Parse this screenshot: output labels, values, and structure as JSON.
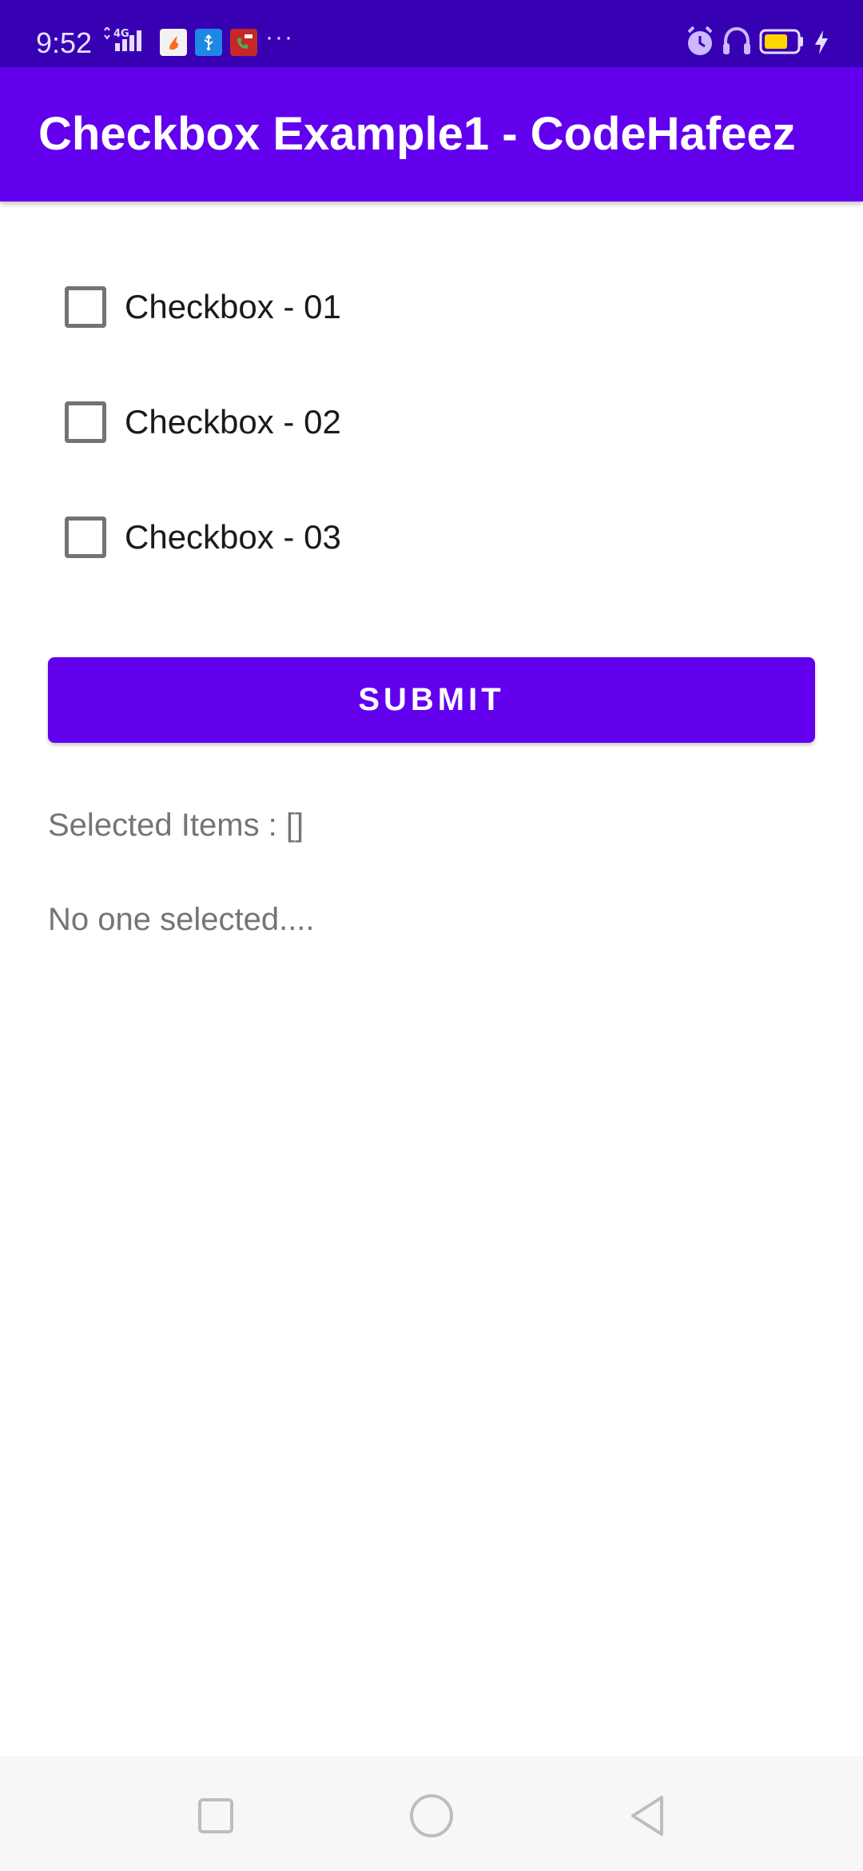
{
  "status_bar": {
    "time": "9:52",
    "network": "4G",
    "more": "···",
    "icons": [
      "signal-icon",
      "app-notification-icon",
      "usb-icon",
      "call-recording-icon",
      "alarm-icon",
      "headphones-icon",
      "battery-icon",
      "charging-icon"
    ]
  },
  "app_bar": {
    "title": "Checkbox Example1 - CodeHafeez"
  },
  "checkboxes": [
    {
      "label": "Checkbox - 01",
      "checked": false
    },
    {
      "label": "Checkbox - 02",
      "checked": false
    },
    {
      "label": "Checkbox - 03",
      "checked": false
    }
  ],
  "submit": {
    "label": "SUBMIT"
  },
  "results": {
    "selected_items": "Selected Items : []",
    "message": "No one selected...."
  },
  "nav_bar": {
    "icons": [
      "recents-square-icon",
      "home-circle-icon",
      "back-triangle-icon"
    ]
  },
  "colors": {
    "status_bar": "#3700b3",
    "primary": "#6200ee",
    "checkbox_border": "#737373",
    "secondary_text": "#757575",
    "nav_bar": "#f7f7f7"
  }
}
